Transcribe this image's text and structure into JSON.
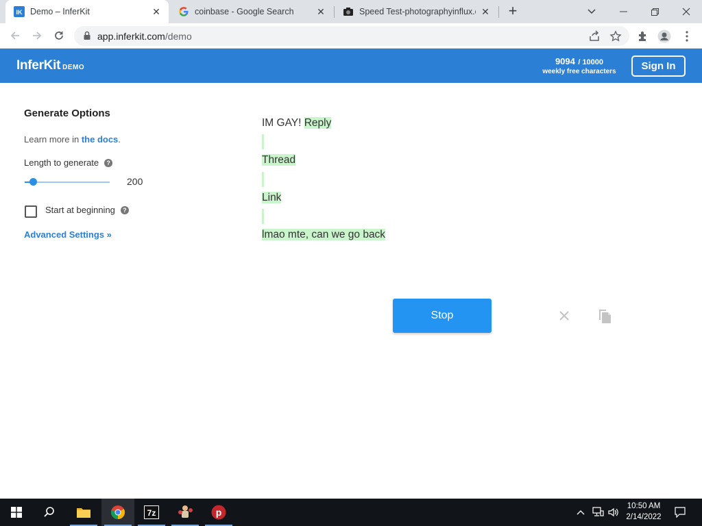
{
  "browser": {
    "tabs": [
      {
        "title": "Demo – InferKit",
        "active": true
      },
      {
        "title": "coinbase - Google Search",
        "active": false
      },
      {
        "title": "Speed Test-photographyinflux.co",
        "active": false
      }
    ],
    "url_host": "app.inferkit.com",
    "url_path": "/demo"
  },
  "header": {
    "logo": "InferKit",
    "logo_badge": "DEMO",
    "chars_used": "9094",
    "chars_max": "/ 10000",
    "chars_label": "weekly free characters",
    "signin_label": "Sign In"
  },
  "options": {
    "title": "Generate Options",
    "learn_prefix": "Learn more in ",
    "learn_link": "the docs",
    "learn_suffix": ".",
    "length_label": "Length to generate",
    "length_value": "200",
    "length_fraction": 0.1,
    "start_label": "Start at beginning",
    "start_checked": false,
    "advanced_label": "Advanced Settings »"
  },
  "output": {
    "prompt": "IM GAY!",
    "gen_first": "Reply",
    "gen_lines": [
      "",
      "Thread",
      "",
      "Link",
      "",
      "lmao mte, can we go back"
    ]
  },
  "actions": {
    "stop_label": "Stop"
  },
  "taskbar": {
    "time": "10:50 AM",
    "date": "2/14/2022"
  },
  "colors": {
    "brand": "#2b7fd4",
    "button": "#2494f2",
    "generated_highlight": "#c9f4cc"
  }
}
